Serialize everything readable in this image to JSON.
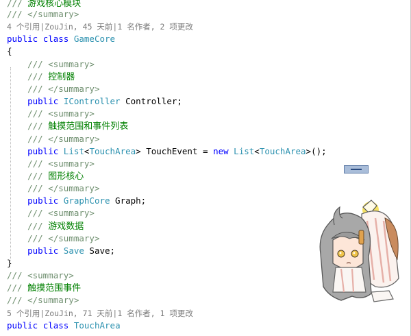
{
  "code": {
    "top_partial": {
      "slashes": "///",
      "text": "游戏核心模块"
    },
    "lines": [
      {
        "id": "l1",
        "indent": "",
        "prefix": "///",
        "text": " </summary>",
        "kind": "doc"
      },
      {
        "id": "lens1",
        "text": "4 个引用|ZouJin, 45 天前|1 名作者, 2 项更改",
        "kind": "lens"
      },
      {
        "id": "l3",
        "parts": [
          [
            "public",
            "kw"
          ],
          [
            " "
          ],
          [
            "class",
            "kw"
          ],
          [
            " "
          ],
          [
            "GameCore",
            "type"
          ]
        ]
      },
      {
        "id": "l4",
        "parts": [
          [
            "{"
          ]
        ]
      },
      {
        "id": "l5",
        "indent": "    ",
        "prefix": "///",
        "text": " <summary>",
        "kind": "doc"
      },
      {
        "id": "l6",
        "indent": "    ",
        "prefix": "/// ",
        "text": "控制器",
        "kind": "cn"
      },
      {
        "id": "l7",
        "indent": "    ",
        "prefix": "///",
        "text": " </summary>",
        "kind": "doc"
      },
      {
        "id": "l8",
        "parts": [
          [
            "    "
          ],
          [
            "public",
            "kw"
          ],
          [
            " "
          ],
          [
            "IController",
            "type"
          ],
          [
            " Controller;"
          ]
        ]
      },
      {
        "id": "l9",
        "indent": "    ",
        "prefix": "///",
        "text": " <summary>",
        "kind": "doc"
      },
      {
        "id": "l10",
        "indent": "    ",
        "prefix": "/// ",
        "text": "触摸范围和事件列表",
        "kind": "cn"
      },
      {
        "id": "l11",
        "indent": "    ",
        "prefix": "///",
        "text": " </summary>",
        "kind": "doc"
      },
      {
        "id": "l12",
        "parts": [
          [
            "    "
          ],
          [
            "public",
            "kw"
          ],
          [
            " "
          ],
          [
            "List",
            "type"
          ],
          [
            "<"
          ],
          [
            "TouchArea",
            "type"
          ],
          [
            "> TouchEvent = "
          ],
          [
            "new",
            "kw"
          ],
          [
            " "
          ],
          [
            "List",
            "type"
          ],
          [
            "<"
          ],
          [
            "TouchArea",
            "type"
          ],
          [
            ">();"
          ]
        ]
      },
      {
        "id": "l13",
        "indent": "    ",
        "prefix": "///",
        "text": " <summary>",
        "kind": "doc"
      },
      {
        "id": "l14",
        "indent": "    ",
        "prefix": "/// ",
        "text": "图形核心",
        "kind": "cn"
      },
      {
        "id": "l15",
        "indent": "    ",
        "prefix": "///",
        "text": " </summary>",
        "kind": "doc"
      },
      {
        "id": "l16",
        "parts": [
          [
            "    "
          ],
          [
            "public",
            "kw"
          ],
          [
            " "
          ],
          [
            "GraphCore",
            "type"
          ],
          [
            " Graph;"
          ]
        ]
      },
      {
        "id": "l17",
        "indent": "    ",
        "prefix": "///",
        "text": " <summary>",
        "kind": "doc"
      },
      {
        "id": "l18",
        "indent": "    ",
        "prefix": "/// ",
        "text": "游戏数据",
        "kind": "cn"
      },
      {
        "id": "l19",
        "indent": "    ",
        "prefix": "///",
        "text": " </summary>",
        "kind": "doc"
      },
      {
        "id": "l20",
        "parts": [
          [
            "    "
          ],
          [
            "public",
            "kw"
          ],
          [
            " "
          ],
          [
            "Save",
            "type"
          ],
          [
            " Save;"
          ]
        ]
      },
      {
        "id": "l21",
        "parts": [
          [
            "}"
          ]
        ]
      },
      {
        "id": "l22",
        "indent": "",
        "prefix": "///",
        "text": " <summary>",
        "kind": "doc"
      },
      {
        "id": "l23",
        "indent": "",
        "prefix": "/// ",
        "text": "触摸范围事件",
        "kind": "cn"
      },
      {
        "id": "l24",
        "indent": "",
        "prefix": "///",
        "text": " </summary>",
        "kind": "doc"
      },
      {
        "id": "lens2",
        "text": "5 个引用|ZouJin, 71 天前|1 名作者, 1 项更改",
        "kind": "lens"
      },
      {
        "id": "l26",
        "parts": [
          [
            "public",
            "kw"
          ],
          [
            " "
          ],
          [
            "class",
            "kw"
          ],
          [
            " "
          ],
          [
            "TouchArea",
            "type"
          ]
        ]
      }
    ]
  },
  "colors": {
    "keyword": "#0000ff",
    "type": "#2b91af",
    "comment": "#6f8f6f",
    "chinese_comment": "#008000",
    "codelens": "#7a7a7a"
  },
  "icons": {
    "scrollbar_marker": "scroll-marker-icon",
    "mascot": "anime-girl-mascot-icon"
  }
}
